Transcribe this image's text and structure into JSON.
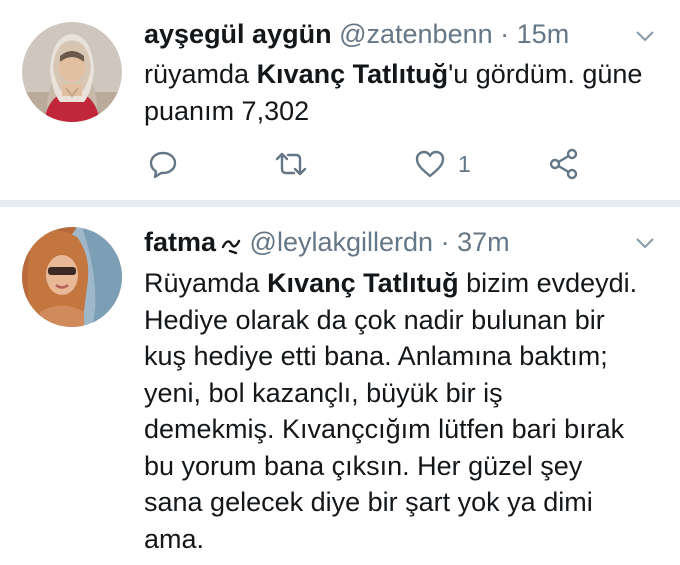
{
  "tweets": [
    {
      "name": "ayşegül aygün",
      "handle": "@zatenbenn",
      "separator": "·",
      "time": "15m",
      "lines": [
        {
          "pre": "rüyamda ",
          "bold": "Kıvanç Tatlıtuğ",
          "post": "'u gördüm. güne"
        },
        {
          "text": "puanım 7,302"
        }
      ],
      "actions": {
        "reply_icon": "reply-icon",
        "retweet_icon": "retweet-icon",
        "like_icon": "heart-icon",
        "like_count": "1",
        "share_icon": "share-icon"
      }
    },
    {
      "name": "fatma",
      "handle": "@leylakgillerdn",
      "separator": "·",
      "time": "37m",
      "lines": [
        {
          "pre": "Rüyamda ",
          "bold": "Kıvanç Tatlıtuğ",
          "post": " bizim evdeydi."
        },
        {
          "text": "Hediye olarak da çok nadir bulunan bir"
        },
        {
          "text": "kuş hediye etti bana. Anlamına baktım;"
        },
        {
          "text": "yeni, bol kazançlı, büyük bir iş"
        },
        {
          "text": "demekmiş. Kıvançcığım lütfen bari bırak"
        },
        {
          "text": "bu yorum bana çıksın. Her güzel şey"
        },
        {
          "text": "sana gelecek diye bir şart yok ya dimi"
        },
        {
          "text": "ama."
        }
      ]
    }
  ],
  "colors": {
    "text": "#14171a",
    "secondary": "#657786",
    "separator": "#e6ecf0"
  }
}
